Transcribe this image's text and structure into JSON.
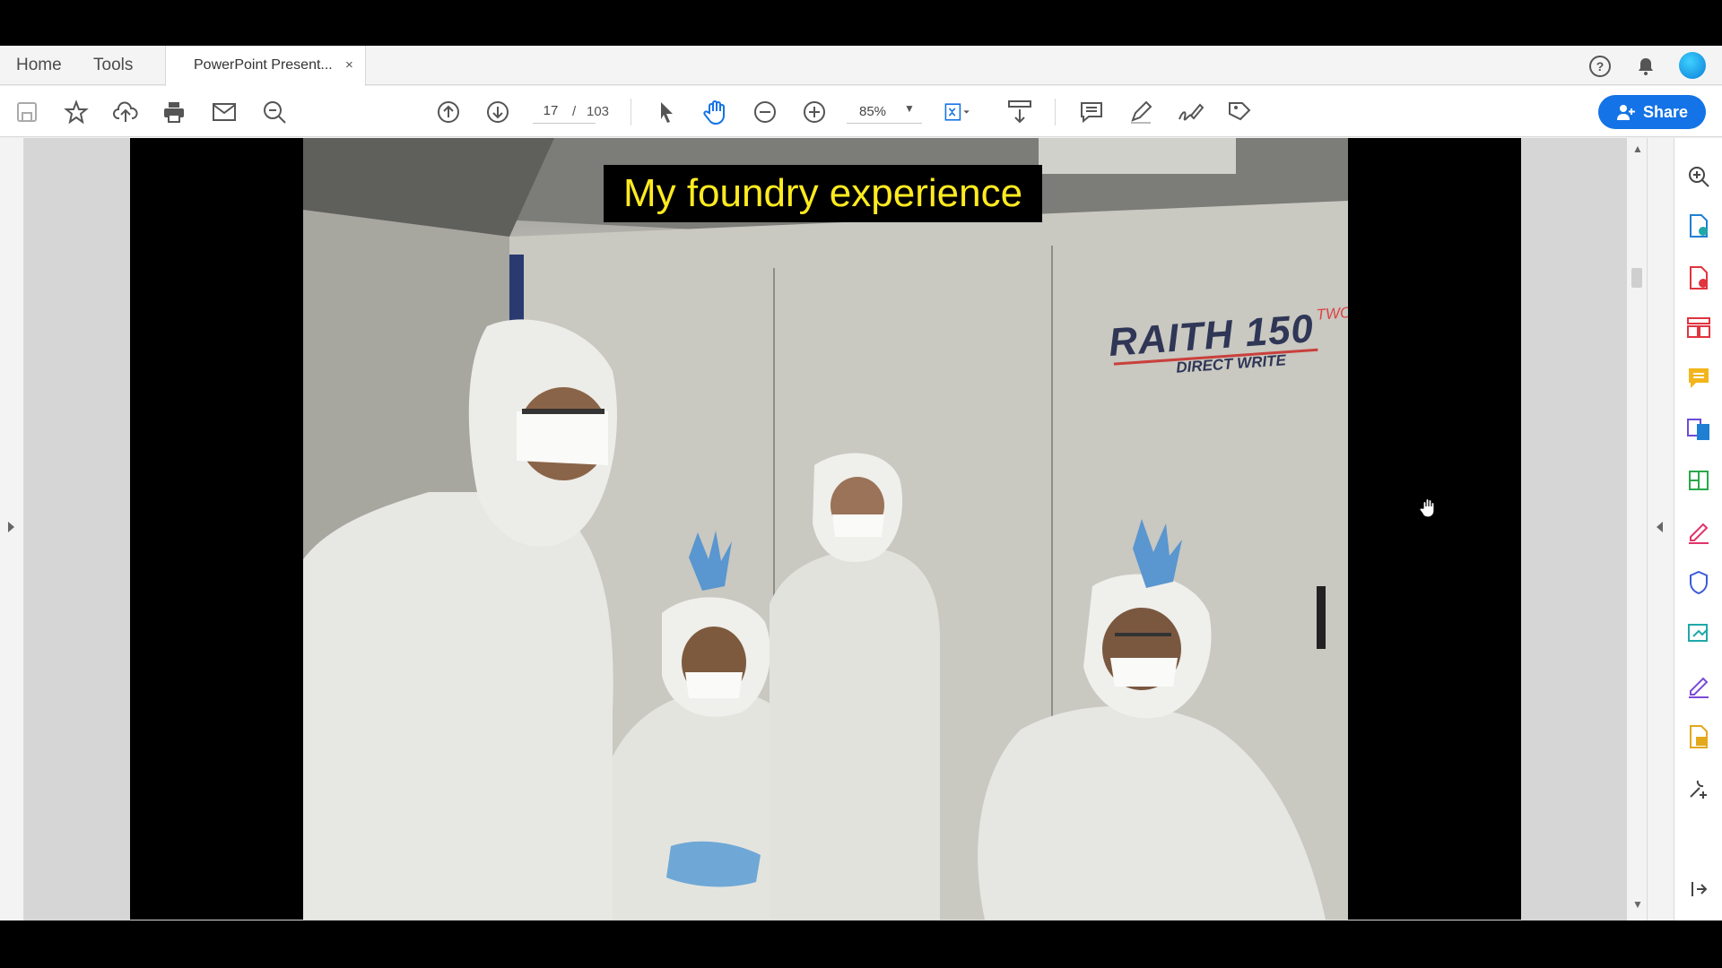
{
  "tabs": {
    "home": "Home",
    "tools": "Tools",
    "document": "PowerPoint Present...",
    "close": "×"
  },
  "toolbar": {
    "page_current": "17",
    "page_separator": "/",
    "page_total": "103",
    "zoom": "85%",
    "share_label": "Share"
  },
  "slide": {
    "title": "My foundry experience",
    "brand_name": "RAITH 150",
    "brand_super": "TWO",
    "brand_sub": "DIRECT WRITE"
  },
  "colors": {
    "accent": "#1473e6",
    "title_text": "#ffeb1f",
    "title_background": "#000000"
  },
  "icons": {
    "top_right": [
      "help-icon",
      "bell-icon",
      "avatar"
    ],
    "toolbar_left": [
      "save-icon",
      "star-icon",
      "cloud-upload-icon",
      "print-icon",
      "mail-icon",
      "zoom-search-icon"
    ],
    "toolbar_nav": [
      "page-up-icon",
      "page-down-icon"
    ],
    "toolbar_view": [
      "select-arrow-icon",
      "hand-icon",
      "zoom-out-icon",
      "zoom-in-icon",
      "fit-page-icon",
      "scroll-mode-icon"
    ],
    "toolbar_annot": [
      "comment-icon",
      "pen-icon",
      "sign-icon",
      "more-tools-icon"
    ],
    "tool_pane": [
      "search-zoom-icon",
      "export-pdf-icon",
      "create-pdf-icon",
      "organize-pages-icon",
      "comment-tool-icon",
      "combine-files-icon",
      "edit-pdf-icon",
      "fill-sign-icon",
      "protect-icon",
      "send-review-icon",
      "sign-tool-icon",
      "export-file-icon",
      "more-tools-icon",
      "collapse-pane-icon"
    ]
  }
}
